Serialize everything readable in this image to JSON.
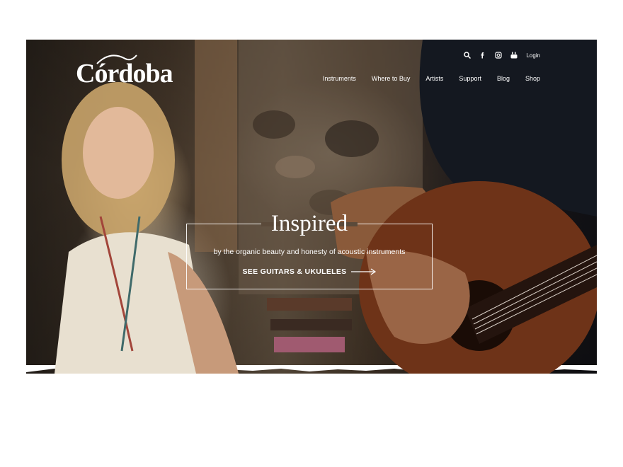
{
  "brand": {
    "logo_text": "Córdoba"
  },
  "topbar": {
    "icons": [
      "search-icon",
      "facebook-icon",
      "instagram-icon",
      "youtube-icon"
    ],
    "login_label": "Login"
  },
  "nav": {
    "items": [
      {
        "label": "Instruments"
      },
      {
        "label": "Where to Buy"
      },
      {
        "label": "Artists"
      },
      {
        "label": "Support"
      },
      {
        "label": "Blog"
      },
      {
        "label": "Shop"
      }
    ]
  },
  "promo": {
    "title": "Inspired",
    "subtitle": "by the organic beauty and honesty of acoustic instruments",
    "cta_label": "SEE GUITARS & UKULELES"
  },
  "colors": {
    "text": "#ffffff",
    "page_background": "#ffffff"
  }
}
